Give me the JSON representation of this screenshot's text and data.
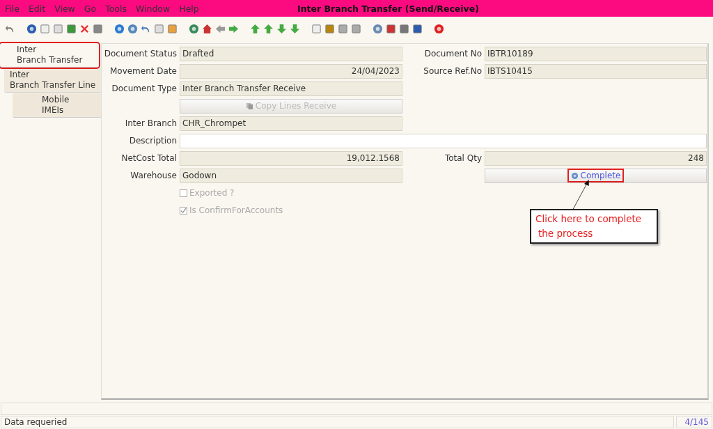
{
  "window": {
    "title": "Inter Branch Transfer (Send/Receive)"
  },
  "menu": [
    {
      "label": "File"
    },
    {
      "label": "Edit"
    },
    {
      "label": "View"
    },
    {
      "label": "Go"
    },
    {
      "label": "Tools"
    },
    {
      "label": "Window"
    },
    {
      "label": "Help"
    }
  ],
  "tabs": [
    {
      "lines": [
        "Inter",
        "Branch Transfer"
      ],
      "selected": true,
      "highlighted": true
    },
    {
      "lines": [
        "Inter",
        "Branch Transfer Line"
      ],
      "selected": false,
      "highlighted": false
    },
    {
      "lines": [
        "Mobile",
        "IMEIs"
      ],
      "selected": false,
      "highlighted": false
    }
  ],
  "form": [
    {
      "kind": "field",
      "label": "Document Status",
      "value": "Drafted"
    },
    {
      "kind": "field",
      "label": "Document No",
      "value": "IBTR10189"
    },
    {
      "kind": "number",
      "label": "Movement Date",
      "value": "24/04/2023"
    },
    {
      "kind": "field",
      "label": "Source Ref.No",
      "value": "IBTS10415"
    },
    {
      "kind": "field",
      "label": "Document Type",
      "value": "Inter Branch Transfer Receive"
    },
    {
      "kind": "gap"
    },
    {
      "kind": "button",
      "label": "Copy Lines Receive",
      "disabled": true,
      "highlighted": false
    },
    {
      "kind": "gap"
    },
    {
      "kind": "field",
      "label": "Inter Branch",
      "value": "CHR_Chrompet"
    },
    {
      "kind": "gap"
    },
    {
      "kind": "input",
      "label": "Description"
    },
    {
      "kind": "number",
      "label": "NetCost Total",
      "value": "19,012.1568"
    },
    {
      "kind": "number",
      "label": "Total Qty",
      "value": "248"
    },
    {
      "kind": "field",
      "label": "Warehouse",
      "value": "Godown"
    },
    {
      "kind": "button",
      "label": "Complete",
      "disabled": false,
      "highlighted": true
    },
    {
      "kind": "checkbox",
      "label": "Exported ?",
      "checked": false,
      "disabled": true
    },
    {
      "kind": "checkbox",
      "label": "Is ConfirmForAccounts",
      "checked": true,
      "disabled": true
    }
  ],
  "callout": {
    "lines": [
      "Click here to complete",
      "the process"
    ]
  },
  "status_bar": {
    "message": "Data requeried",
    "record": "4/145"
  }
}
